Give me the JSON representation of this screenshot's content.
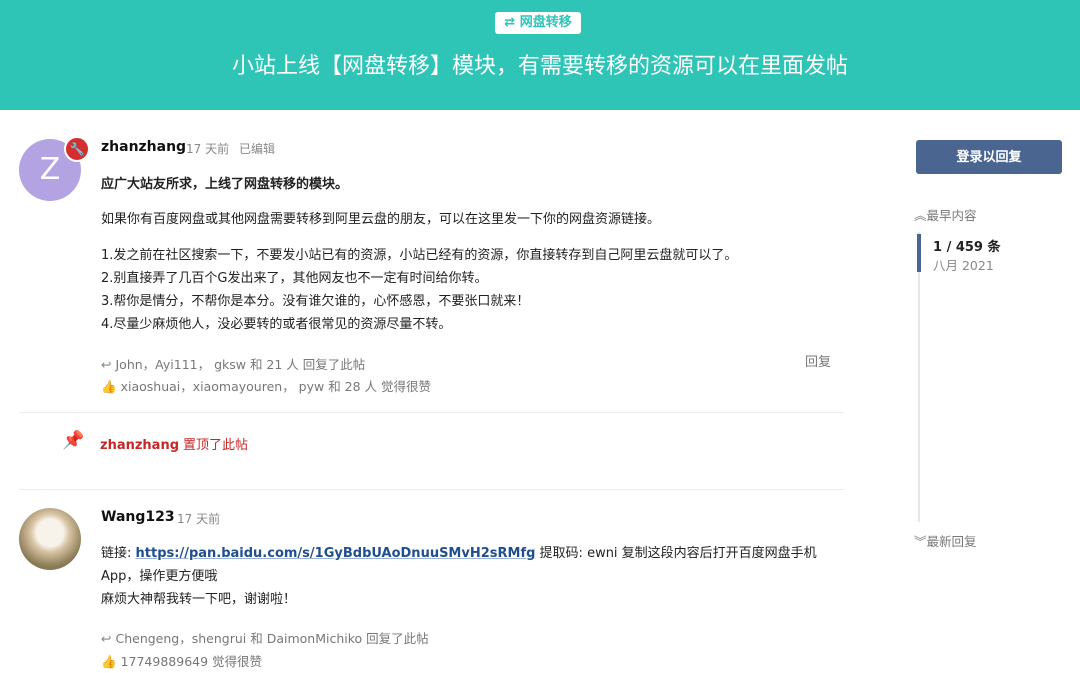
{
  "hero": {
    "category_tag": "⇄ 网盘转移",
    "title": "小站上线【网盘转移】模块，有需要转移的资源可以在里面发帖"
  },
  "post1": {
    "avatar_letter": "Z",
    "username": "zhanzhang",
    "time": "17 天前",
    "edited": "已编辑",
    "heading": "应广大站友所求，上线了网盘转移的模块。",
    "intro": "如果你有百度网盘或其他网盘需要转移到阿里云盘的朋友，可以在这里发一下你的网盘资源链接。",
    "rules": [
      "1.发之前在社区搜索一下，不要发小站已有的资源，小站已经有的资源，你直接转存到自己阿里云盘就可以了。",
      "2.别直接弄了几百个G发出来了，其他网友也不一定有时间给你转。",
      "3.帮你是情分，不帮你是本分。没有谁欠谁的，心怀感恩，不要张口就来！",
      "4.尽量少麻烦他人，没必要转的或者很常见的资源尽量不转。"
    ],
    "replied_by": "John，Ayi111， gksw 和 21 人 回复了此帖",
    "liked_by": "xiaoshuai，xiaomayouren， pyw 和 28 人 觉得很赞",
    "reply_label": "回复"
  },
  "pinned_event": {
    "username": "zhanzhang",
    "text": "置顶了此帖"
  },
  "post2": {
    "username": "Wang123",
    "time": "17 天前",
    "link_prefix": "链接: ",
    "link": "https://pan.baidu.com/s/1GyBdbUAoDnuuSMvH2sRMfg",
    "link_suffix_1": " 提取码: ewni 复制这段内容后打开百度网盘手机",
    "link_suffix_2": "App，操作更方便哦",
    "request": "麻烦大神帮我转一下吧，谢谢啦！",
    "replied_by": "Chengeng，shengrui 和 DaimonMichiko 回复了此帖",
    "liked_by": "17749889649 觉得很赞"
  },
  "sidebar": {
    "login_button": "登录以回复",
    "earliest": "最早内容",
    "position": "1 / 459 条",
    "date": "八月 2021",
    "latest": "最新回复"
  },
  "colors": {
    "accent": "#2ec4b6",
    "button": "#4a6690",
    "pinned": "#c62828"
  }
}
